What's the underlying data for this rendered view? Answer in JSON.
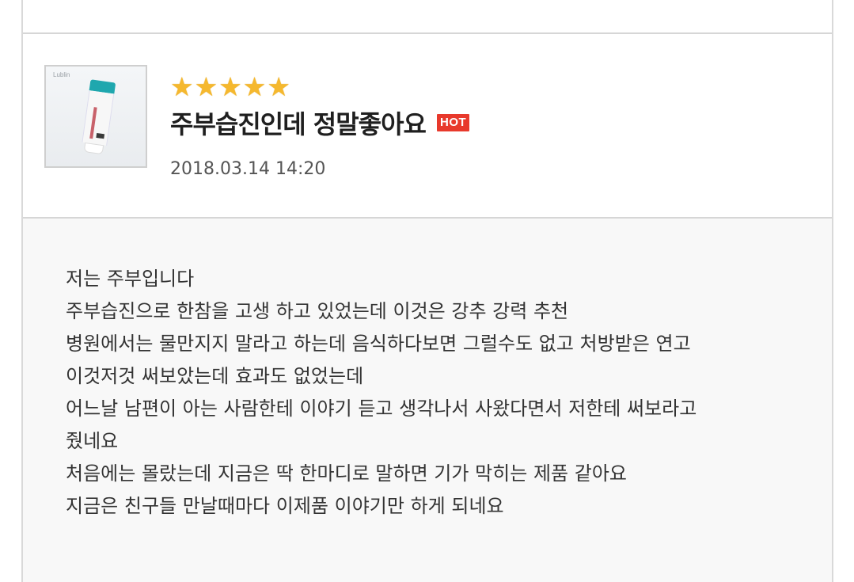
{
  "review": {
    "product_image": {
      "brand_text": "Lublin",
      "icon": "product-thumbnail-icon"
    },
    "rating": 5,
    "rating_max": 5,
    "star_glyph": "★",
    "star_color": "#f5b82e",
    "title": "주부습진인데 정말좋아요",
    "badge": "HOT",
    "badge_color": "#e8392c",
    "date": "2018.03.14 14:20",
    "body_lines": [
      "저는 주부입니다",
      "주부습진으로 한참을 고생 하고 있었는데 이것은 강추 강력 추천",
      "병원에서는 물만지지 말라고 하는데 음식하다보면 그럴수도 없고 처방받은 연고",
      "이것저것 써보았는데 효과도 없었는데",
      "어느날 남편이 아는 사람한테 이야기 듣고 생각나서 사왔다면서 저한테 써보라고",
      "줬네요",
      "처음에는 몰랐는데 지금은 딱 한마디로 말하면 기가 막히는 제품 같아요",
      "지금은 친구들 만날때마다 이제품 이야기만 하게 되네요"
    ]
  }
}
